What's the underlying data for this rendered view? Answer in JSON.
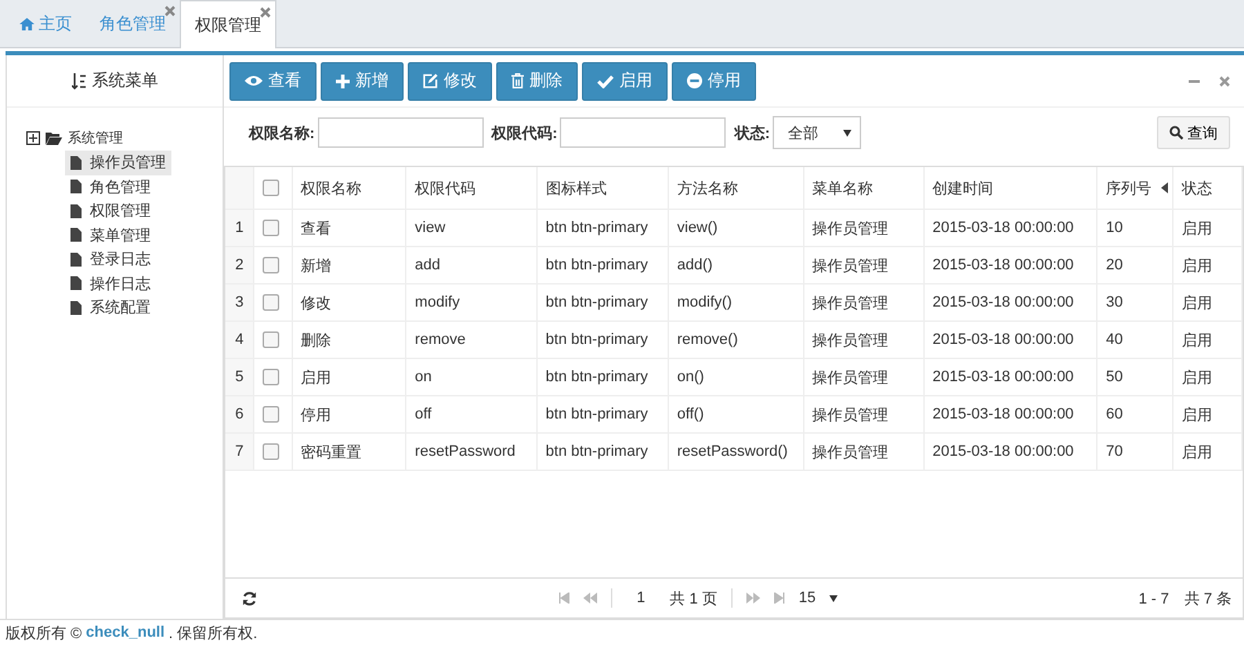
{
  "tabs": [
    {
      "label": "主页",
      "kind": "home",
      "selected": false
    },
    {
      "label": "角色管理",
      "kind": "page",
      "selected": false
    },
    {
      "label": "权限管理",
      "kind": "page",
      "selected": true
    }
  ],
  "sidebar": {
    "title": "系统菜单",
    "tree": {
      "label": "系统管理",
      "children": [
        {
          "label": "操作员管理",
          "selected": true
        },
        {
          "label": "角色管理",
          "selected": false
        },
        {
          "label": "权限管理",
          "selected": false
        },
        {
          "label": "菜单管理",
          "selected": false
        },
        {
          "label": "登录日志",
          "selected": false
        },
        {
          "label": "操作日志",
          "selected": false
        },
        {
          "label": "系统配置",
          "selected": false
        }
      ]
    }
  },
  "toolbar": [
    {
      "label": "查看",
      "kind": "view"
    },
    {
      "label": "新增",
      "kind": "add"
    },
    {
      "label": "修改",
      "kind": "edit"
    },
    {
      "label": "删除",
      "kind": "delete"
    },
    {
      "label": "启用",
      "kind": "enable"
    },
    {
      "label": "停用",
      "kind": "disable"
    }
  ],
  "filters": [
    {
      "label": "权限名称:",
      "kind": "text"
    },
    {
      "label": "权限代码:",
      "kind": "text"
    },
    {
      "label": "状态:",
      "kind": "select",
      "value": "全部"
    }
  ],
  "search_button": "查询",
  "table": {
    "header_checked": false,
    "columns": [
      {
        "label": "权限名称",
        "sorted": false
      },
      {
        "label": "权限代码",
        "sorted": false
      },
      {
        "label": "图标样式",
        "sorted": false
      },
      {
        "label": "方法名称",
        "sorted": false
      },
      {
        "label": "菜单名称",
        "sorted": false
      },
      {
        "label": "创建时间",
        "sorted": false
      },
      {
        "label": "序列号",
        "sorted": true
      },
      {
        "label": "状态",
        "sorted": false
      }
    ],
    "rows": [
      {
        "index": "1",
        "checked": false,
        "cells": [
          "查看",
          "view",
          "btn btn-primary",
          "view()",
          "操作员管理",
          "2015-03-18 00:00:00",
          "10",
          "启用"
        ]
      },
      {
        "index": "2",
        "checked": false,
        "cells": [
          "新增",
          "add",
          "btn btn-primary",
          "add()",
          "操作员管理",
          "2015-03-18 00:00:00",
          "20",
          "启用"
        ]
      },
      {
        "index": "3",
        "checked": false,
        "cells": [
          "修改",
          "modify",
          "btn btn-primary",
          "modify()",
          "操作员管理",
          "2015-03-18 00:00:00",
          "30",
          "启用"
        ]
      },
      {
        "index": "4",
        "checked": false,
        "cells": [
          "删除",
          "remove",
          "btn btn-primary",
          "remove()",
          "操作员管理",
          "2015-03-18 00:00:00",
          "40",
          "启用"
        ]
      },
      {
        "index": "5",
        "checked": false,
        "cells": [
          "启用",
          "on",
          "btn btn-primary",
          "on()",
          "操作员管理",
          "2015-03-18 00:00:00",
          "50",
          "启用"
        ]
      },
      {
        "index": "6",
        "checked": false,
        "cells": [
          "停用",
          "off",
          "btn btn-primary",
          "off()",
          "操作员管理",
          "2015-03-18 00:00:00",
          "60",
          "启用"
        ]
      },
      {
        "index": "7",
        "checked": false,
        "cells": [
          "密码重置",
          "resetPassword",
          "btn btn-primary",
          "resetPassword()",
          "操作员管理",
          "2015-03-18 00:00:00",
          "70",
          "启用"
        ]
      }
    ]
  },
  "pager": {
    "page": "1",
    "total_pages": "共 1 页",
    "page_size": "15",
    "summary": "1 - 7　共 7 条"
  },
  "footer": {
    "prefix": "版权所有 ©",
    "link": "check_null",
    "suffix": ". 保留所有权."
  }
}
